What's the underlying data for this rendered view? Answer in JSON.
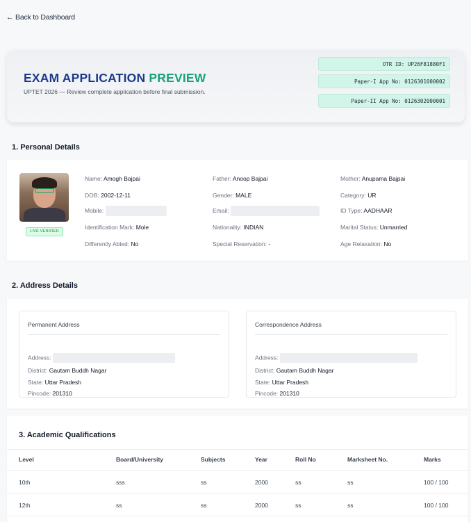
{
  "nav": {
    "back_label": "← Back to Dashboard"
  },
  "header": {
    "title_main": "EXAM APPLICATION ",
    "title_accent": "PREVIEW",
    "subtitle": "UPTET 2026 — Review complete application before final submission.",
    "otr": "OTR ID: UP26F81880F1",
    "paper1": "Paper-I App No: 0126301000002",
    "paper2": "Paper-II App No: 0126302000001"
  },
  "personal": {
    "title": "1. Personal Details",
    "photo_badge": "LIVE VERIFIED",
    "name_label": "Name:",
    "name": "Amogh Bajpai",
    "father_label": "Father:",
    "father": "Anoop Bajpai",
    "mother_label": "Mother:",
    "mother": "Anupama Bajpai",
    "dob_label": "DOB:",
    "dob": "2002-12-11",
    "gender_label": "Gender:",
    "gender": "MALE",
    "category_label": "Category:",
    "category": "UR",
    "mobile_label": "Mobile:",
    "email_label": "Email:",
    "idtype_label": "ID Type:",
    "idtype": "AADHAAR",
    "idmark_label": "Identification Mark:",
    "idmark": "Mole",
    "nationality_label": "Nationality:",
    "nationality": "INDIAN",
    "marital_label": "Marital Status:",
    "marital": "Unmarried",
    "disabled_label": "Differently Abled:",
    "disabled": "No",
    "special_label": "Special Reservation:",
    "special": "-",
    "age_label": "Age Relaxation:",
    "age": "No"
  },
  "address": {
    "title": "2. Address Details",
    "permanent": {
      "title": "Permanent Address",
      "address_label": "Address:",
      "district_label": "District:",
      "district": "Gautam Buddh Nagar",
      "state_label": "State:",
      "state": "Uttar Pradesh",
      "pincode_label": "Pincode:",
      "pincode": "201310"
    },
    "correspondence": {
      "title": "Correspondence Address",
      "address_label": "Address:",
      "district_label": "District:",
      "district": "Gautam Buddh Nagar",
      "state_label": "State:",
      "state": "Uttar Pradesh",
      "pincode_label": "Pincode:",
      "pincode": "201310"
    }
  },
  "academic": {
    "title": "3. Academic Qualifications",
    "headers": [
      "Level",
      "Board/University",
      "Subjects",
      "Year",
      "Roll No",
      "Marksheet No.",
      "Marks"
    ],
    "rows": [
      [
        "10th",
        "sss",
        "ss",
        "2000",
        "ss",
        "ss",
        "100 / 100"
      ],
      [
        "12th",
        "ss",
        "ss",
        "2000",
        "ss",
        "ss",
        "100 / 100"
      ]
    ]
  }
}
